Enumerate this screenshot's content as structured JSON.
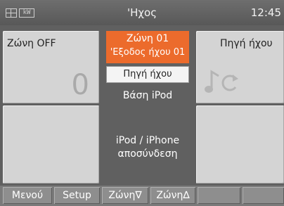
{
  "header": {
    "logo_text": "kW",
    "title": "'Ηχος",
    "clock": "12:45"
  },
  "left_top": {
    "label": "Ζώνη OFF",
    "volume": "0"
  },
  "center": {
    "zone_name": "Ζώνη 01",
    "zone_output": "'Εξοδος ήχου 01",
    "source_button": "Πηγή ήχου",
    "dock_label": "Βάση  iPod",
    "disconnect_line1": "iPod / iPhone",
    "disconnect_line2": "αποσύνδεση"
  },
  "right_top": {
    "label": "Πηγή ήχου"
  },
  "bottom_bar": {
    "menu": "Μενού",
    "setup": "Setup",
    "zone_down": "Ζώνη∇",
    "zone_up": "Ζώνη∆"
  },
  "colors": {
    "accent": "#ec6b2c",
    "background": "#606060",
    "tile": "#d4d4d4"
  }
}
